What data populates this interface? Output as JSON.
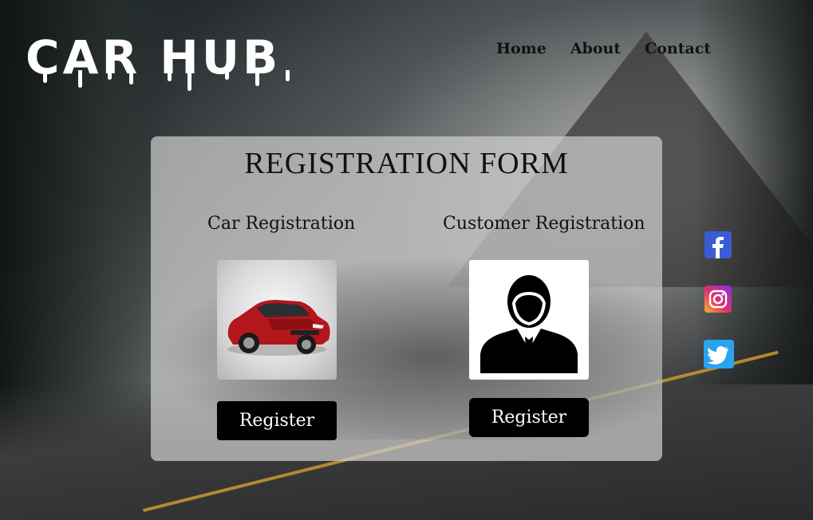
{
  "header": {
    "logo_text": "CAR HUB",
    "nav": [
      {
        "label": "Home"
      },
      {
        "label": "About"
      },
      {
        "label": "Contact"
      }
    ]
  },
  "form": {
    "title": "REGISTRATION FORM",
    "car": {
      "title": "Car Registration",
      "image": "red-car-photo",
      "button_label": "Register"
    },
    "customer": {
      "title": "Customer Registration",
      "image": "person-avatar-icon",
      "button_label": "Register"
    }
  },
  "social": [
    {
      "name": "facebook-icon",
      "color": "#3b5bd6"
    },
    {
      "name": "instagram-icon",
      "color": "#e1306c"
    },
    {
      "name": "twitter-icon",
      "color": "#2aa3ef"
    }
  ],
  "colors": {
    "button_bg": "#000000",
    "button_text": "#ffffff"
  }
}
